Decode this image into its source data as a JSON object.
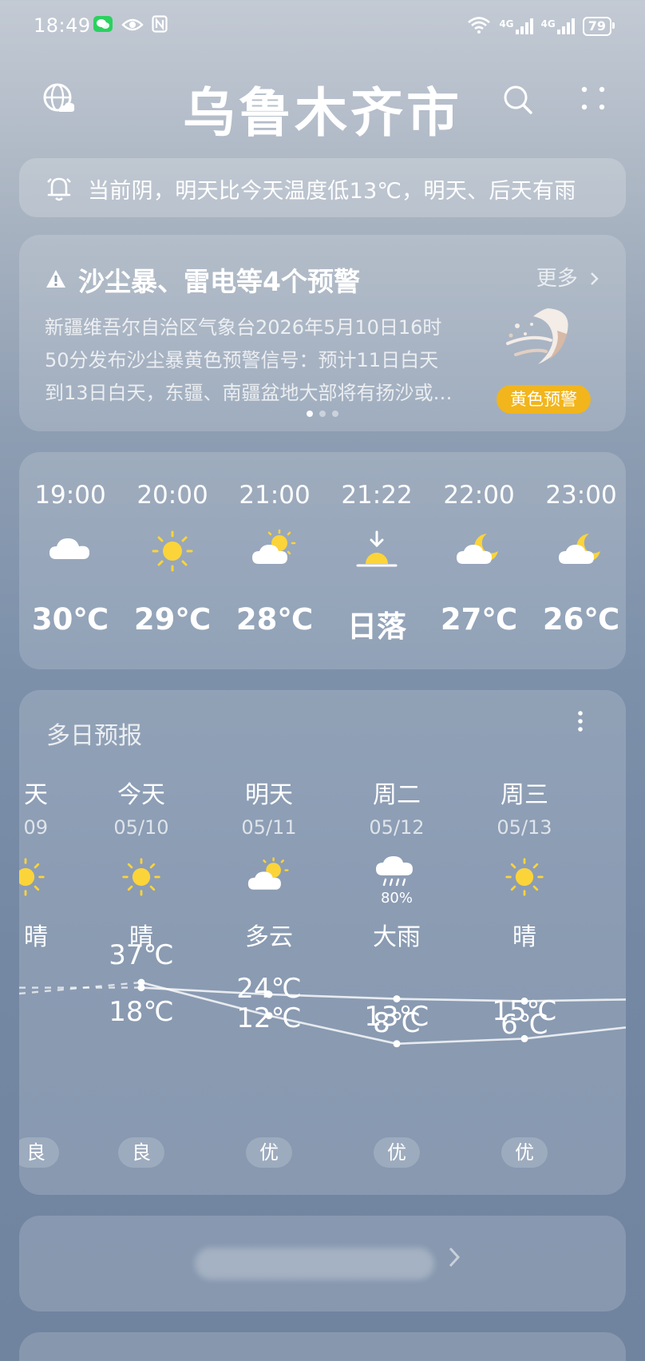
{
  "status_bar": {
    "time": "18:49",
    "network_left": "4G",
    "network_right": "4G",
    "battery": "79"
  },
  "header": {
    "city": "乌鲁木齐市",
    "globe_icon": "globe-cloud-icon",
    "search_icon": "search-icon",
    "more_icon": "more-dots-icon"
  },
  "notice": {
    "text": "当前阴，明天比今天温度低13℃，明天、后天有雨"
  },
  "warning": {
    "title": "沙尘暴、雷电等4个预警",
    "more_label": "更多",
    "body_lines": [
      "新疆维吾尔自治区气象台2026年5月10日16时",
      "50分发布沙尘暴黄色预警信号：预计11日白天",
      "到13日白天，东疆、南疆盆地大部将有扬沙或…"
    ],
    "badge": "黄色预警",
    "badge_color": "#f2b51b"
  },
  "hourly": [
    {
      "time": "19:00",
      "icon": "cloudy-icon",
      "value": "30℃"
    },
    {
      "time": "20:00",
      "icon": "sunny-icon",
      "value": "29℃"
    },
    {
      "time": "21:00",
      "icon": "partly-cloudy-icon",
      "value": "28℃"
    },
    {
      "time": "21:22",
      "icon": "sunset-icon",
      "value": "日落"
    },
    {
      "time": "22:00",
      "icon": "cloudy-night-icon",
      "value": "27℃"
    },
    {
      "time": "23:00",
      "icon": "cloudy-night-icon",
      "value": "26℃"
    }
  ],
  "daily": {
    "title": "多日预报",
    "more_icon": "vertical-dots-icon",
    "days": [
      {
        "day": "天",
        "date": "09",
        "icon": "sunny-icon",
        "precip": "",
        "cond": "晴",
        "high": "℃",
        "low": "℃",
        "aqi": "良"
      },
      {
        "day": "今天",
        "date": "05/10",
        "icon": "sunny-icon",
        "precip": "",
        "cond": "晴",
        "high": "37℃",
        "low": "18℃",
        "aqi": "良"
      },
      {
        "day": "明天",
        "date": "05/11",
        "icon": "partly-cloudy-icon",
        "precip": "",
        "cond": "多云",
        "high": "24℃",
        "low": "12℃",
        "aqi": "优"
      },
      {
        "day": "周二",
        "date": "05/12",
        "icon": "heavy-rain-icon",
        "precip": "80%",
        "cond": "大雨",
        "high": "13℃",
        "low": "8℃",
        "aqi": "优"
      },
      {
        "day": "周三",
        "date": "05/13",
        "icon": "sunny-icon",
        "precip": "",
        "cond": "晴",
        "high": "15℃",
        "low": "6℃",
        "aqi": "优"
      }
    ]
  }
}
